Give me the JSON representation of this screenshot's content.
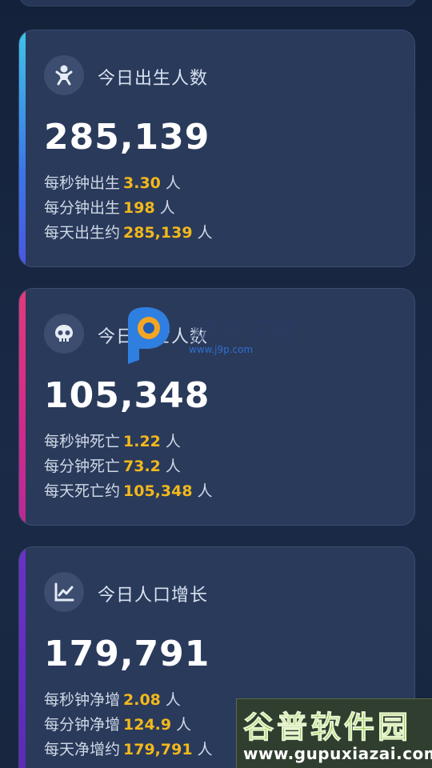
{
  "cards": [
    {
      "title": "今日出生人数",
      "icon": "baby-icon",
      "total": "285,139",
      "accent_color": "#3b76e8",
      "stats": [
        {
          "prefix": "每秒钟出生",
          "value": "3.30",
          "suffix": "人"
        },
        {
          "prefix": "每分钟出生",
          "value": "198",
          "suffix": "人"
        },
        {
          "prefix": "每天出生约",
          "value": "285,139",
          "suffix": "人"
        }
      ]
    },
    {
      "title": "今日死亡人数",
      "icon": "skull-icon",
      "total": "105,348",
      "accent_color": "#d02a8b",
      "stats": [
        {
          "prefix": "每秒钟死亡",
          "value": "1.22",
          "suffix": "人"
        },
        {
          "prefix": "每分钟死亡",
          "value": "73.2",
          "suffix": "人"
        },
        {
          "prefix": "每天死亡约",
          "value": "105,348",
          "suffix": "人"
        }
      ]
    },
    {
      "title": "今日人口增长",
      "icon": "line-chart-icon",
      "total": "179,791",
      "accent_color": "#5a2ab8",
      "stats": [
        {
          "prefix": "每秒钟净增",
          "value": "2.08",
          "suffix": "人"
        },
        {
          "prefix": "每分钟净增",
          "value": "124.9",
          "suffix": "人"
        },
        {
          "prefix": "每天净增约",
          "value": "179,791",
          "suffix": "人"
        }
      ]
    }
  ],
  "watermarks": {
    "center_text": "精品下载",
    "center_url": "www.j9p.com",
    "corner_text": "谷普软件园",
    "corner_url": "www.gupuxiazai.com"
  },
  "colors": {
    "background": "#17253f",
    "card": "#2a3a5b",
    "highlight_value": "#f2b81c"
  }
}
